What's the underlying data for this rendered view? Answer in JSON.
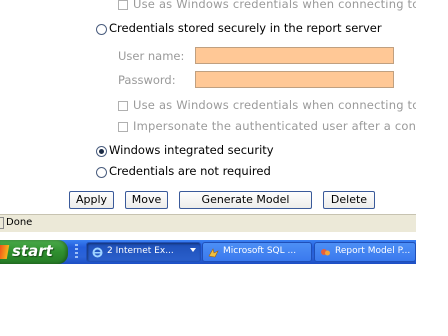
{
  "form": {
    "use_windows_creds_1": "Use as Windows credentials when connecting to",
    "radio_stored": "Credentials stored securely in the report server",
    "user_name_label": "User name:",
    "password_label": "Password:",
    "user_name_value": "",
    "password_value": "",
    "use_windows_creds_2": "Use as Windows credentials when connecting to",
    "impersonate": "Impersonate the authenticated user after a conr",
    "radio_windows": "Windows integrated security",
    "radio_none": "Credentials are not required",
    "selected_option": "Windows integrated security"
  },
  "buttons": {
    "apply": "Apply",
    "move": "Move",
    "generate": "Generate Model",
    "delete": "Delete"
  },
  "statusbar": {
    "text": "Done"
  },
  "taskbar": {
    "start": "start",
    "tasks": [
      {
        "label": "2 Internet Ex...",
        "icon": "ie-icon",
        "active": true
      },
      {
        "label": "Microsoft SQL ...",
        "icon": "sql-icon",
        "active": false
      },
      {
        "label": "Report Model P...",
        "icon": "report-model-icon",
        "active": false
      }
    ]
  },
  "colors": {
    "field_bg": "#ffc896",
    "taskbar": "#245edb",
    "start": "#2f8f2f",
    "status_bg": "#ece9d8"
  }
}
